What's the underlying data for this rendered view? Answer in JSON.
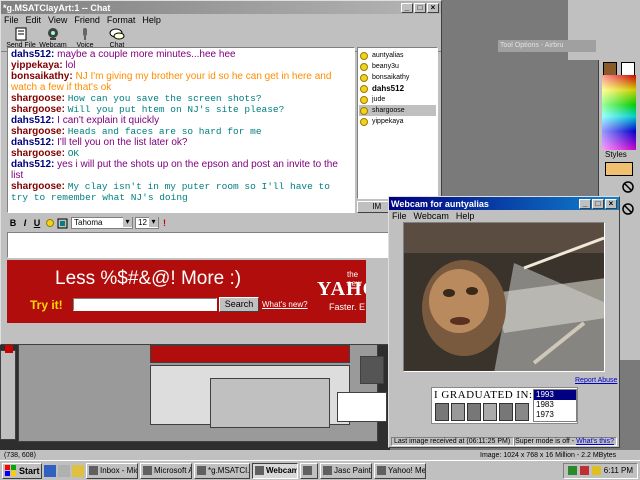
{
  "chat": {
    "title": "*g.MSATClayArt:1 -- Chat",
    "menu": [
      "File",
      "Edit",
      "View",
      "Friend",
      "Format",
      "Help"
    ],
    "tools": [
      "Send File",
      "Webcam",
      "Voice",
      "Chat"
    ],
    "messages": [
      {
        "who": "dahs512:",
        "text": "maybe a couple more minutes...hee hee",
        "who_color": "#000080",
        "text_color": "#800080",
        "mono": false
      },
      {
        "who": "yippekaya:",
        "text": "lol",
        "who_color": "#800000",
        "text_color": "#800080",
        "mono": false
      },
      {
        "who": "bonsaikathy:",
        "text": "NJ I'm giving my brother your id so he can get in here and watch a few if that's ok",
        "who_color": "#800000",
        "text_color": "#ff8c00",
        "mono": false
      },
      {
        "who": "shargoose:",
        "text": "How can you save the screen shots?",
        "who_color": "#800000",
        "text_color": "#008080",
        "mono": true
      },
      {
        "who": "shargoose:",
        "text": "Will you put htem on NJ's site please?",
        "who_color": "#800000",
        "text_color": "#008080",
        "mono": true
      },
      {
        "who": "dahs512:",
        "text": "I can't explain it quickly",
        "who_color": "#000080",
        "text_color": "#800080",
        "mono": false
      },
      {
        "who": "shargoose:",
        "text": "Heads and faces are so hard for me",
        "who_color": "#800000",
        "text_color": "#008080",
        "mono": true
      },
      {
        "who": "dahs512:",
        "text": "I'll tell you on the list later ok?",
        "who_color": "#000080",
        "text_color": "#800080",
        "mono": false
      },
      {
        "who": "shargoose:",
        "text": "OK",
        "who_color": "#800000",
        "text_color": "#008080",
        "mono": true
      },
      {
        "who": "dahs512:",
        "text": "yes i will put the shots up on the epson and post an invite to the list",
        "who_color": "#000080",
        "text_color": "#800080",
        "mono": false
      },
      {
        "who": "shargoose:",
        "text": "My clay isn't in my puter room so I'll have to try to remember what NJ's doing",
        "who_color": "#800000",
        "text_color": "#008080",
        "mono": true
      }
    ],
    "buddies": [
      {
        "name": "auntyalias",
        "bold": false,
        "selected": false
      },
      {
        "name": "beany3u",
        "bold": false,
        "selected": false
      },
      {
        "name": "bonsaikathy",
        "bold": false,
        "selected": false
      },
      {
        "name": "dahs512",
        "bold": true,
        "selected": false
      },
      {
        "name": "jude",
        "bold": false,
        "selected": false
      },
      {
        "name": "shargoose",
        "bold": false,
        "selected": true
      },
      {
        "name": "yippekaya",
        "bold": false,
        "selected": false
      }
    ],
    "im_button": "IM",
    "format": {
      "bold": "B",
      "italic": "I",
      "underline": "U",
      "font": "Tahoma",
      "size": "12"
    },
    "ad": {
      "headline": "Less %$#&@!  More :)",
      "try_it": "Try it!",
      "search": "Search",
      "whats_new": "What's new?",
      "the_new": "the new",
      "brand": "YAHO",
      "tagline": "Faster. E"
    }
  },
  "webcam": {
    "title": "Webcam for auntyalias",
    "menu": [
      "File",
      "Webcam",
      "Help"
    ],
    "report": "Report Abuse",
    "graduated": "I GRADUATED IN:",
    "years": [
      "1993",
      "1983",
      "1973"
    ],
    "status_left": "Last image received at (06:11:25 PM)",
    "status_right_prefix": "Super mode is off - ",
    "status_link": "What's this?"
  },
  "tool_options": "Tool Options - Airbru",
  "palette": {
    "styles": "Styles"
  },
  "statusbar": {
    "coords": "(738, 608)",
    "image_info": "Image:  1024 x 768 x 16 Million - 2.2 MBytes"
  },
  "taskbar": {
    "start": "Start",
    "tasks": [
      {
        "label": "Inbox - Mic...",
        "active": false
      },
      {
        "label": "Microsoft A...",
        "active": false
      },
      {
        "label": "*g.MSATCl...",
        "active": false
      },
      {
        "label": "Webcam...",
        "active": true
      },
      {
        "label": "",
        "active": false
      },
      {
        "label": "Jasc Paint...",
        "active": false
      },
      {
        "label": "Yahoo! Me...",
        "active": false
      }
    ],
    "clock": "6:11 PM"
  }
}
